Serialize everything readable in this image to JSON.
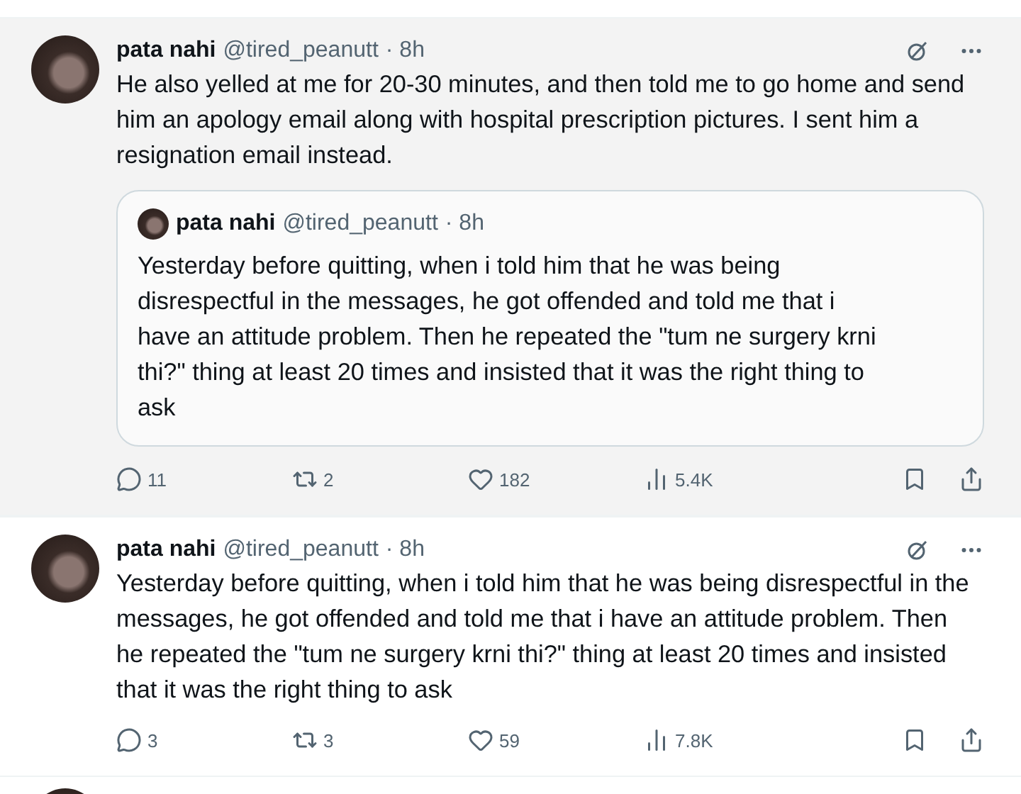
{
  "posts": [
    {
      "highlighted": true,
      "name": "pata nahi",
      "handle": "@tired_peanutt",
      "time": "· 8h",
      "text": "He also yelled at me for 20-30 minutes, and then told me to go home and send him an apology email along with hospital prescription pictures. I sent him a resignation email instead.",
      "quote": {
        "name": "pata nahi",
        "handle": "@tired_peanutt",
        "time": "· 8h",
        "text": "Yesterday before quitting, when i told him that he was being disrespectful in the messages, he got offended and told me that i have an attitude problem. Then he repeated the \"tum ne surgery krni thi?\" thing at least 20 times and insisted that it was the right thing to ask"
      },
      "replies": "11",
      "reposts": "2",
      "likes": "182",
      "views": "5.4K"
    },
    {
      "highlighted": false,
      "name": "pata nahi",
      "handle": "@tired_peanutt",
      "time": "· 8h",
      "text": "Yesterday before quitting, when i told him that he was being disrespectful in the messages, he got offended and told me that i have an attitude problem. Then he repeated the \"tum ne surgery krni thi?\" thing at least 20 times and insisted that it was the right thing to ask",
      "replies": "3",
      "reposts": "3",
      "likes": "59",
      "views": "7.8K"
    }
  ],
  "next_post_peek": true
}
